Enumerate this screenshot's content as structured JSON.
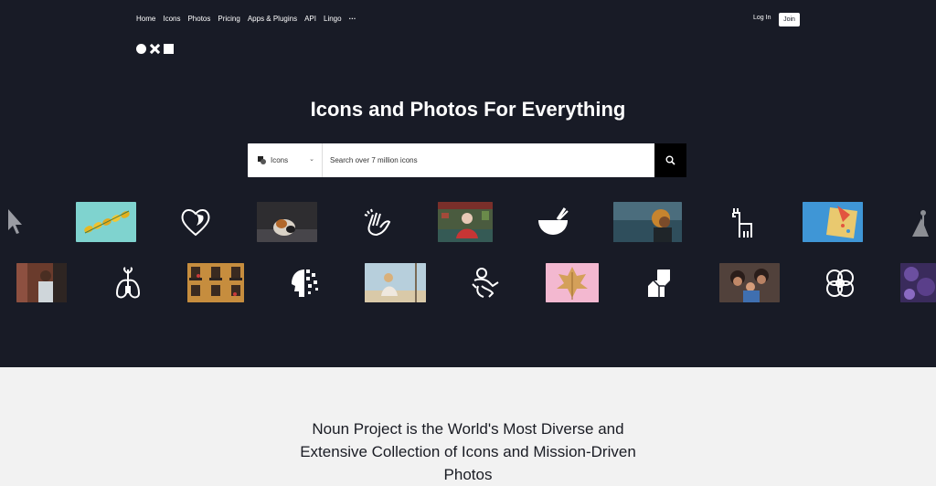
{
  "nav": {
    "items": [
      "Home",
      "Icons",
      "Photos",
      "Pricing",
      "Apps & Plugins",
      "API",
      "Lingo"
    ],
    "more": "···",
    "login": "Log In",
    "join": "Join"
  },
  "hero": {
    "headline": "Icons and Photos For Everything"
  },
  "search": {
    "type_label": "Icons",
    "placeholder": "Search over 7 million icons"
  },
  "gallery": {
    "row1": [
      "cursor-icon",
      "photo-butterflies",
      "heart-face-icon",
      "photo-cat",
      "clapping-hands-icon",
      "photo-pixel-portrait",
      "mortar-pestle-icon",
      "photo-woman-sea",
      "llama-icon",
      "photo-board-game",
      "figure-icon"
    ],
    "row2": [
      "photo-man-doorway",
      "lungs-plant-icon",
      "photo-building-balconies",
      "face-pixels-icon",
      "photo-woman-swing",
      "person-sitting-icon",
      "photo-leaf-pink",
      "blocks-icon",
      "photo-family",
      "knot-pattern-icon",
      "photo-purple-texture"
    ]
  },
  "lower": {
    "heading_line1": "Noun Project is the World's Most Diverse and",
    "heading_line2": "Extensive Collection of Icons and Mission-Driven",
    "heading_line3": "Photos"
  },
  "colors": {
    "hero_bg": "#181b26",
    "lower_bg": "#f2f2f2",
    "search_button": "#000000"
  }
}
